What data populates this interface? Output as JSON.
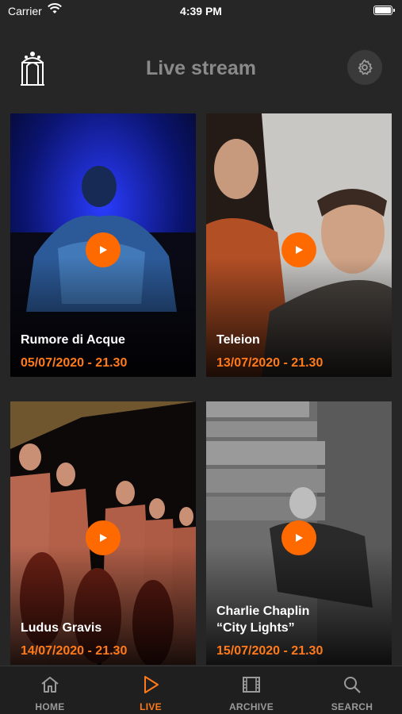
{
  "status": {
    "carrier": "Carrier",
    "time": "4:39 PM"
  },
  "header": {
    "title": "Live stream"
  },
  "events": [
    {
      "name": "Rumore di Acque",
      "date": "05/07/2020 - 21.30"
    },
    {
      "name": "Teleion",
      "date": "13/07/2020 - 21.30"
    },
    {
      "name": "Ludus Gravis",
      "date": "14/07/2020 - 21.30"
    },
    {
      "name": "Charlie Chaplin\n“City Lights”",
      "date": "15/07/2020 - 21.30"
    }
  ],
  "tabs": [
    {
      "label": "HOME",
      "icon": "home-icon"
    },
    {
      "label": "LIVE",
      "icon": "play-outline-icon",
      "active": true
    },
    {
      "label": "ARCHIVE",
      "icon": "film-icon"
    },
    {
      "label": "SEARCH",
      "icon": "search-icon"
    }
  ],
  "colors": {
    "accent": "#ff7a1a",
    "play": "#ff6a00",
    "background": "#262626"
  }
}
